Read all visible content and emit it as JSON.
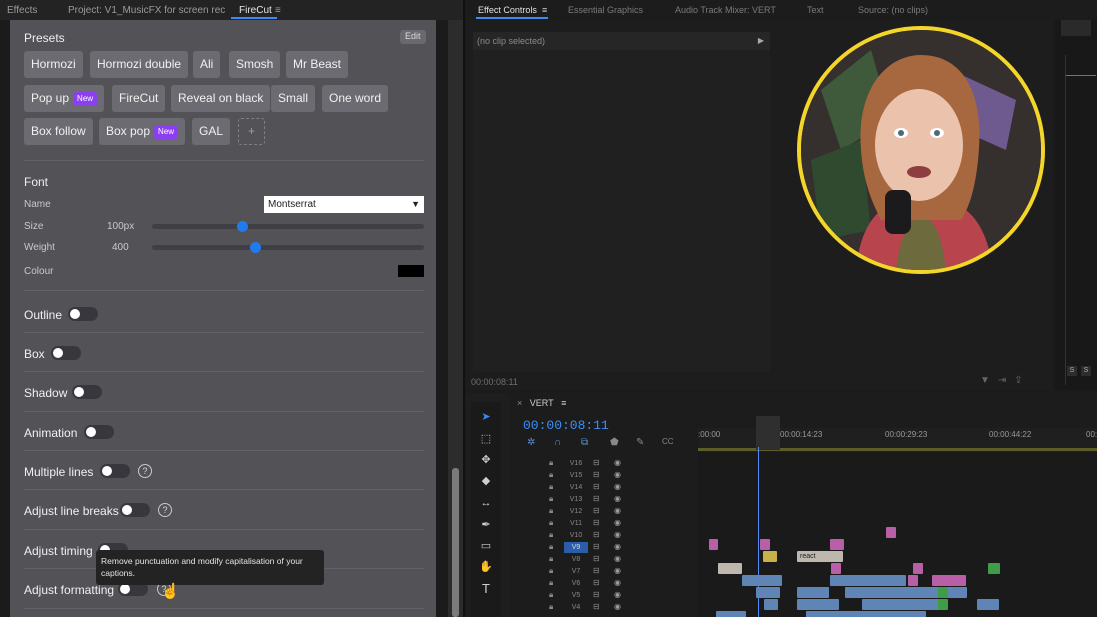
{
  "left_tabs": {
    "effects": "Effects",
    "project": "Project: V1_MusicFX for screen rec",
    "firecut": "FireCut",
    "menu": "≡"
  },
  "presets": {
    "title": "Presets",
    "edit": "Edit",
    "chips": [
      "Hormozi",
      "Hormozi double",
      "Ali",
      "Smosh",
      "Mr Beast",
      "Pop up",
      "FireCut",
      "Reveal on black",
      "Small",
      "One word",
      "Box follow",
      "Box pop",
      "GAL"
    ],
    "new_badge": "New",
    "add": "+"
  },
  "font": {
    "title": "Font",
    "name_label": "Name",
    "name_value": "Montserrat",
    "size_label": "Size",
    "size_value": "100px",
    "weight_label": "Weight",
    "weight_value": "400",
    "colour_label": "Colour",
    "colour": "#000000"
  },
  "options": [
    "Outline",
    "Box",
    "Shadow",
    "Animation",
    "Multiple lines",
    "Adjust line breaks",
    "Adjust timing",
    "Adjust formatting"
  ],
  "tooltip": "Remove punctuation and modify capitalisation of your captions.",
  "right_tabs": {
    "effect_controls": "Effect Controls",
    "menu": "≡",
    "essential": "Essential Graphics",
    "mixer": "Audio Track Mixer: VERT",
    "text": "Text",
    "source": "Source: (no clips)"
  },
  "effect_controls": {
    "no_clip": "(no clip selected)",
    "time": "00:00:08:11"
  },
  "timeline": {
    "close": "×",
    "seq_name": "VERT",
    "menu": "≡",
    "timecode": "00:00:08:11",
    "ruler": [
      ":00:00",
      "00:00:14:23",
      "00:00:29:23",
      "00:00:44:22",
      "00:0"
    ],
    "tracks": [
      "V16",
      "V15",
      "V14",
      "V13",
      "V12",
      "V11",
      "V10",
      "V9",
      "V8",
      "V7",
      "V6",
      "V5",
      "V4"
    ],
    "target_track": "V9",
    "clip_label": "react"
  },
  "side_buttons": [
    "S",
    "S"
  ],
  "colors": {
    "accent": "#1e7bf0",
    "new_badge": "#8b3ff0",
    "face_ring": "#f4d52a",
    "timecode": "#3d8ff7"
  }
}
